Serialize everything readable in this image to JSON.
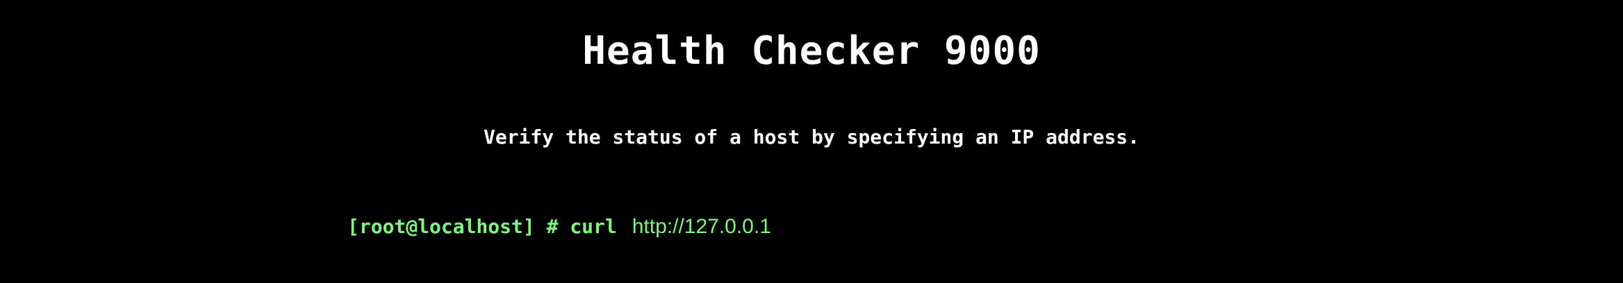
{
  "header": {
    "title": "Health Checker 9000",
    "subtitle": "Verify the status of a host by specifying an IP address."
  },
  "terminal": {
    "prompt": "[root@localhost] # curl",
    "url_value": "http://127.0.0.1"
  },
  "colors": {
    "background": "#000000",
    "text": "#ffffff",
    "accent": "#7CF87C"
  }
}
